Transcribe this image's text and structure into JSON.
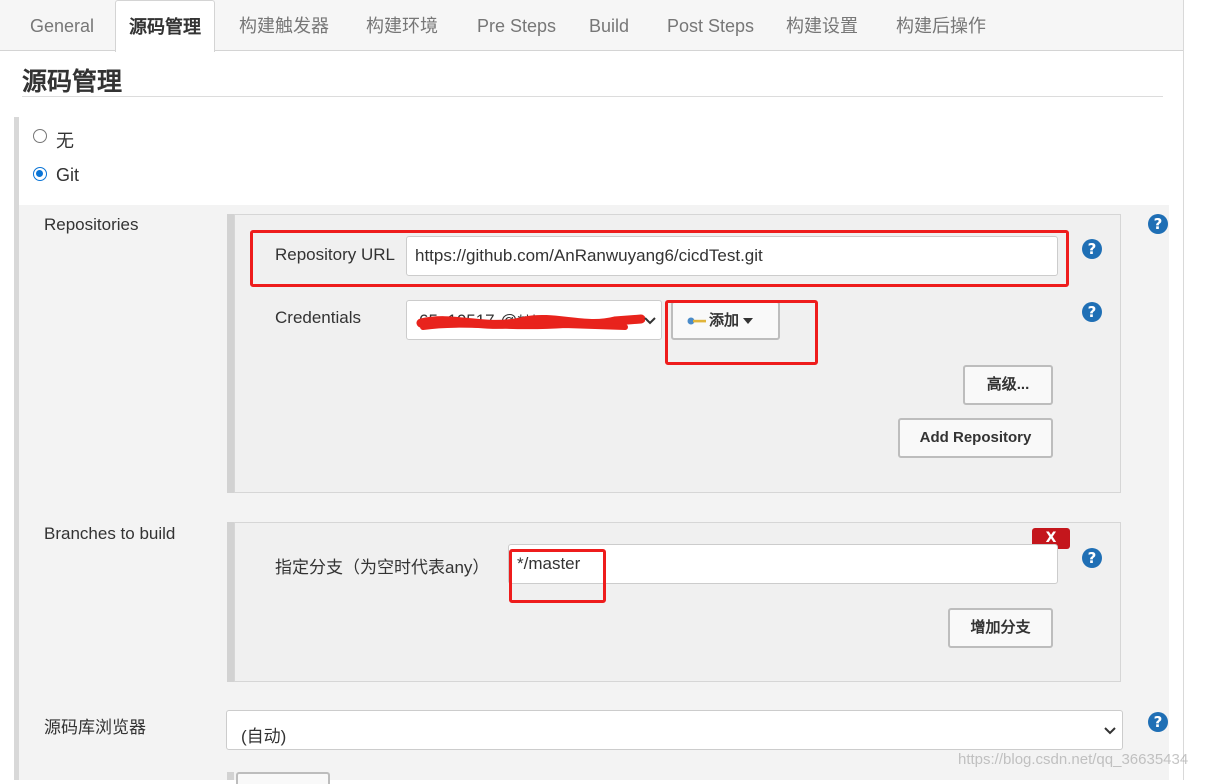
{
  "tabs": [
    {
      "label": "General",
      "active": false
    },
    {
      "label": "源码管理",
      "active": true
    },
    {
      "label": "构建触发器",
      "active": false
    },
    {
      "label": "构建环境",
      "active": false
    },
    {
      "label": "Pre Steps",
      "active": false
    },
    {
      "label": "Build",
      "active": false
    },
    {
      "label": "Post Steps",
      "active": false
    },
    {
      "label": "构建设置",
      "active": false
    },
    {
      "label": "构建后操作",
      "active": false
    }
  ],
  "section": {
    "title": "源码管理"
  },
  "scm_options": [
    {
      "label": "无",
      "selected": false
    },
    {
      "label": "Git",
      "selected": true
    }
  ],
  "repositories": {
    "label": "Repositories",
    "url_label": "Repository URL",
    "url_value": "https://github.com/AnRanwuyang6/cicdTest.git",
    "credentials_label": "Credentials",
    "credentials_value": "65a10517-@***",
    "add_button": "添加",
    "advanced_button": "高级...",
    "add_repo_button": "Add Repository"
  },
  "branches": {
    "label": "Branches to build",
    "spec_label": "指定分支（为空时代表any）",
    "spec_value": "*/master",
    "delete_label": "X",
    "add_branch_button": "增加分支"
  },
  "browser": {
    "label": "源码库浏览器",
    "value": "(自动)"
  },
  "watermark": "https://blog.csdn.net/qq_36635434",
  "colors": {
    "accent": "#0a74d6",
    "help": "#1f6fb5",
    "highlight": "#ee1c1c",
    "delete": "#c4161c"
  },
  "icons": {
    "help": "question-mark-circle",
    "add": "key-icon",
    "dropdown": "chevron-down"
  }
}
